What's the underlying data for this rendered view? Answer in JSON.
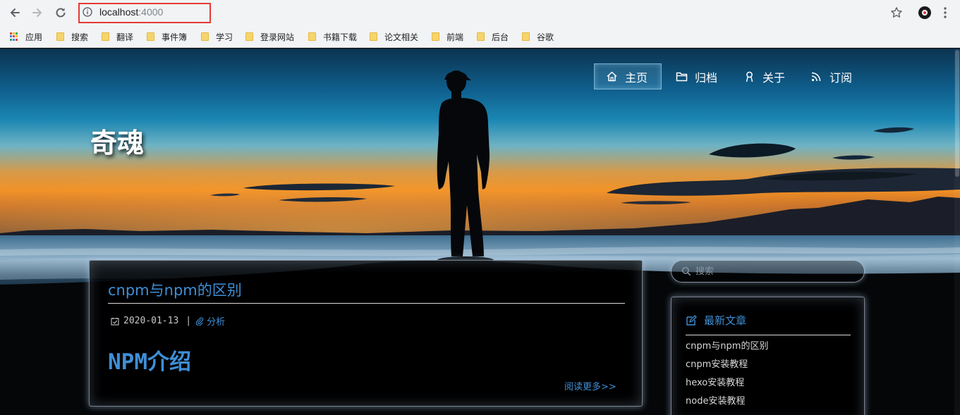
{
  "browser": {
    "url_host": "localhost",
    "url_port": ":4000",
    "bookmarks": [
      {
        "label": "应用",
        "icon": "apps-grid-icon"
      },
      {
        "label": "搜索",
        "icon": "folder-icon"
      },
      {
        "label": "翻译",
        "icon": "folder-icon"
      },
      {
        "label": "事件簿",
        "icon": "folder-icon"
      },
      {
        "label": "学习",
        "icon": "folder-icon"
      },
      {
        "label": "登录网站",
        "icon": "folder-icon"
      },
      {
        "label": "书籍下载",
        "icon": "folder-icon"
      },
      {
        "label": "论文相关",
        "icon": "folder-icon"
      },
      {
        "label": "前端",
        "icon": "folder-icon"
      },
      {
        "label": "后台",
        "icon": "folder-icon"
      },
      {
        "label": "谷歌",
        "icon": "folder-icon"
      }
    ]
  },
  "site": {
    "title": "奇魂",
    "nav": [
      {
        "label": "主页",
        "icon": "home-icon",
        "active": true
      },
      {
        "label": "归档",
        "icon": "folder-icon",
        "active": false
      },
      {
        "label": "关于",
        "icon": "user-icon",
        "active": false
      },
      {
        "label": "订阅",
        "icon": "rss-icon",
        "active": false
      }
    ]
  },
  "post": {
    "title": "cnpm与npm的区别",
    "date": "2020-01-13",
    "separator": "|",
    "category": "分析",
    "excerpt_heading": "NPM介绍",
    "read_more": "阅读更多>>"
  },
  "sidebar": {
    "search_placeholder": "搜索",
    "recent_title": "最新文章",
    "recent_posts": [
      "cnpm与npm的区别",
      "cnpm安装教程",
      "hexo安装教程",
      "node安装教程"
    ]
  },
  "colors": {
    "accent": "#3f8fd6",
    "url_highlight": "#e53935"
  }
}
